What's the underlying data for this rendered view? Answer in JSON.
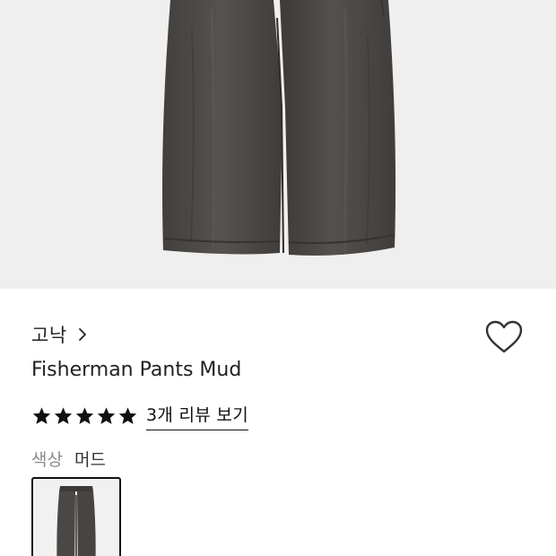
{
  "product": {
    "brand": "고낙",
    "brand_chevron_icon": "chevron-right-icon",
    "title": "Fisherman Pants Mud",
    "wishlist_icon": "heart-outline-icon",
    "rating": {
      "stars": 5,
      "max_stars": 5,
      "star_icon": "star-filled-icon",
      "review_link": "3개 리뷰 보기"
    },
    "color": {
      "label": "색상",
      "value": "머드",
      "swatch_count": 1
    },
    "hero_image": "dark-gray-wide-leg-trousers"
  },
  "colors": {
    "hero_background": "#efefef",
    "pants": "#4a4846",
    "text": "#222222",
    "muted": "#8a8a8a"
  }
}
